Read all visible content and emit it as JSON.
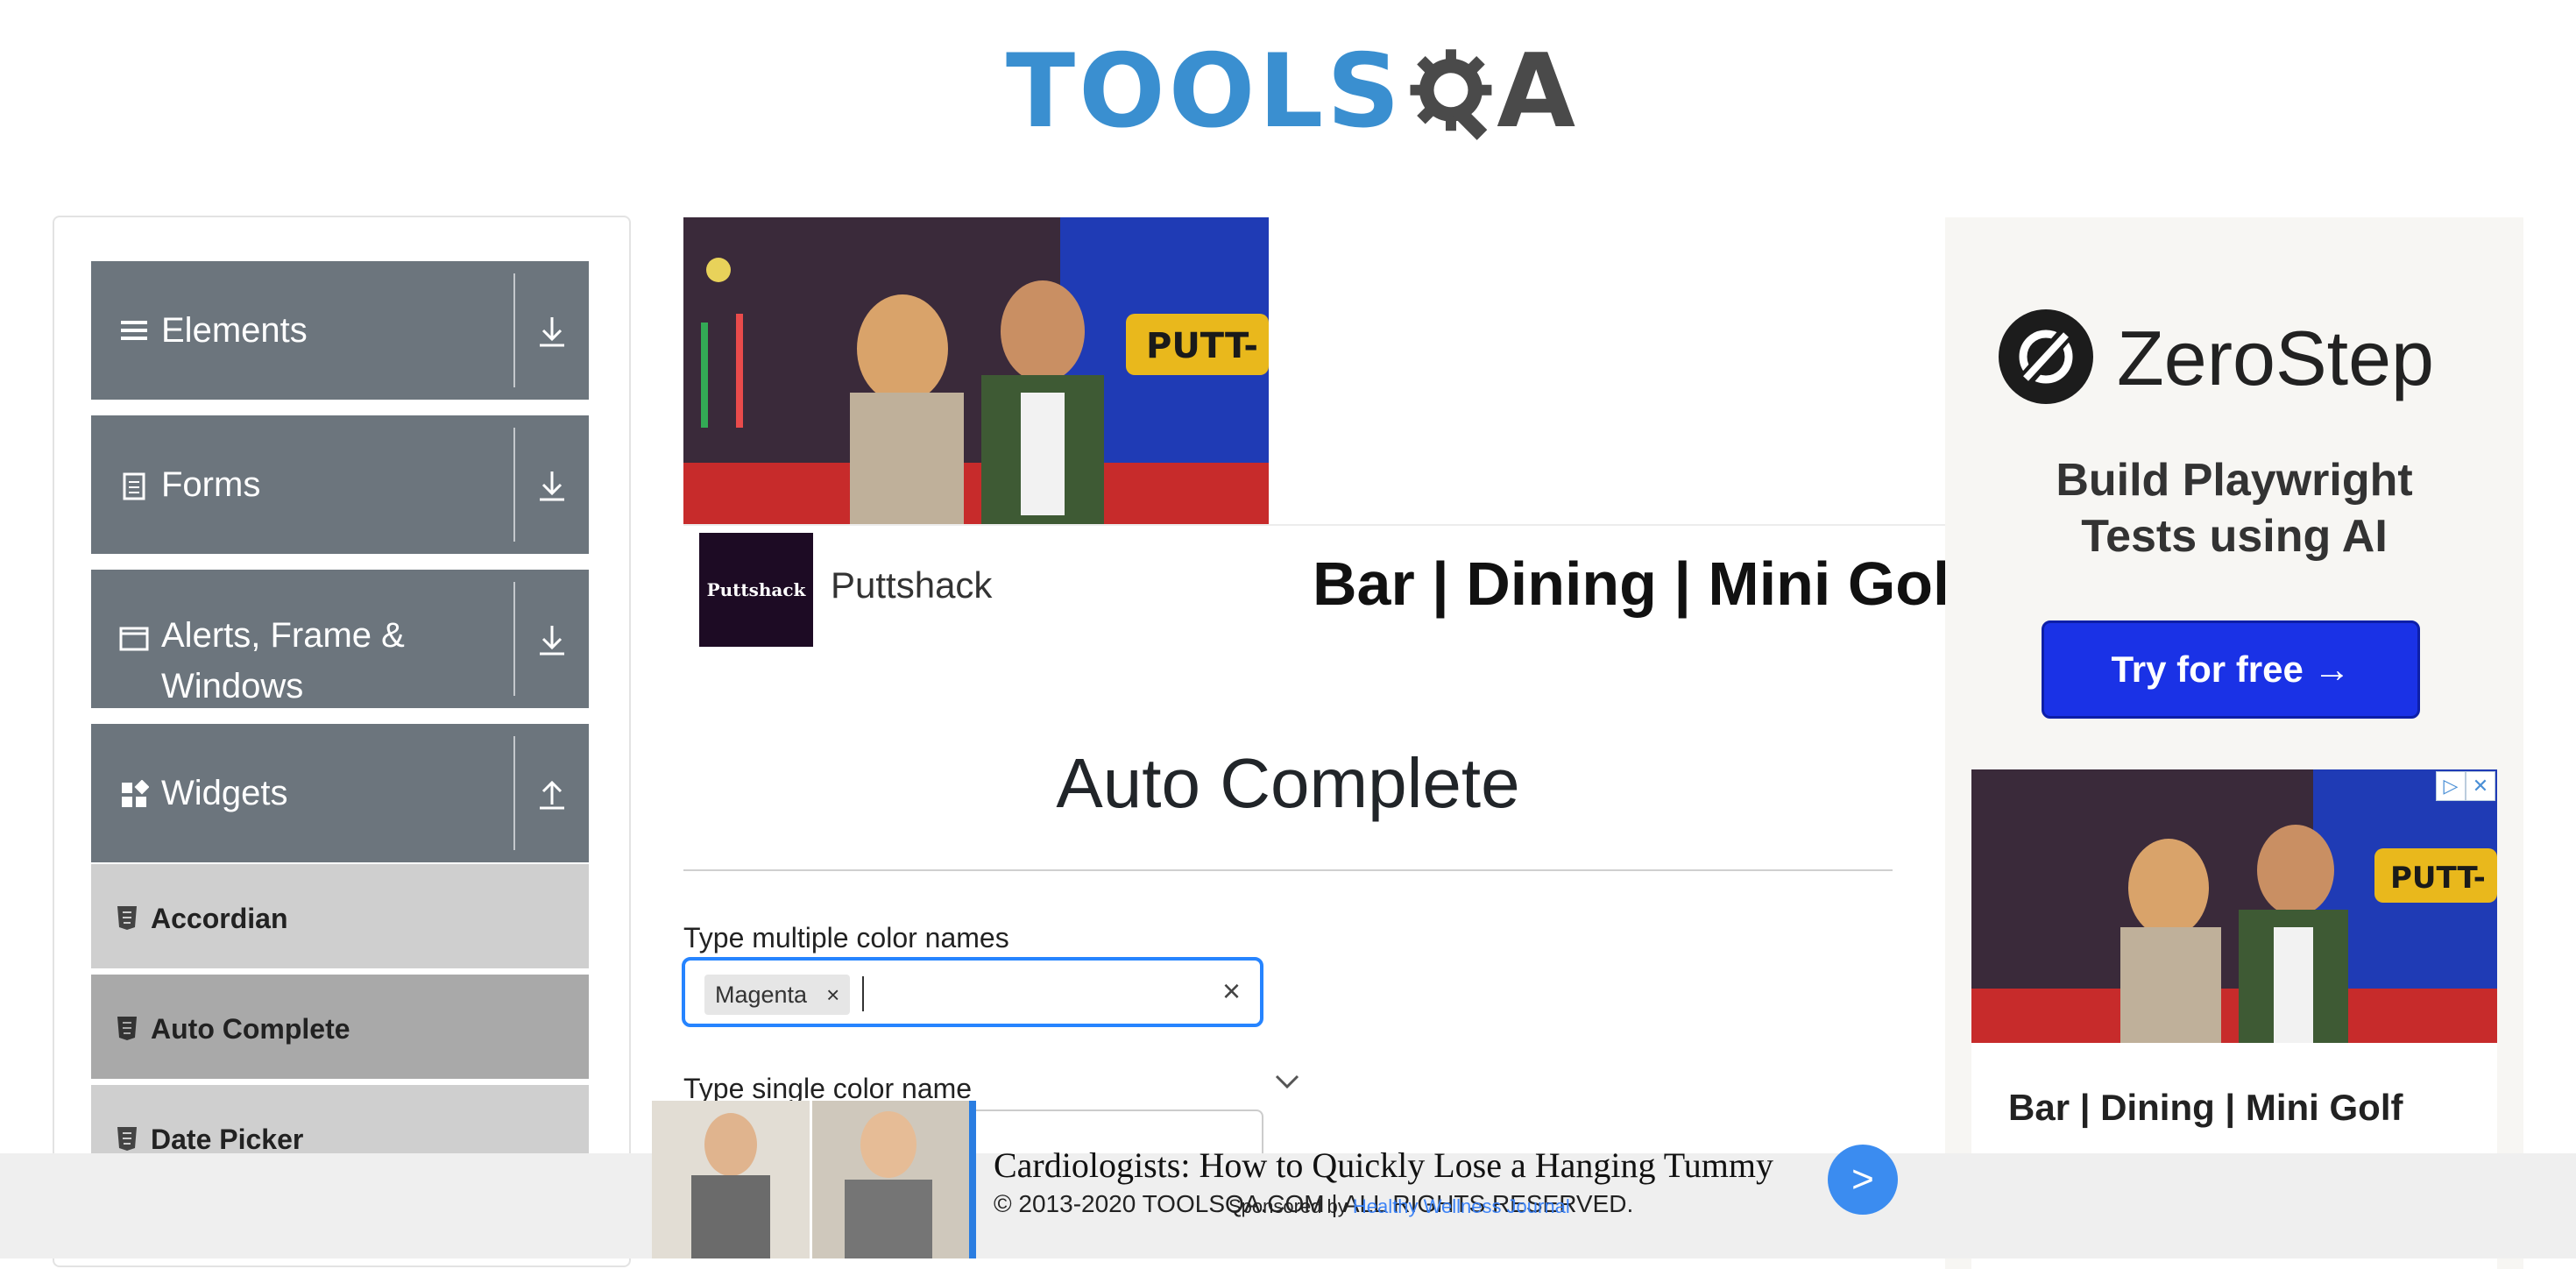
{
  "header": {
    "logo_text": "TOOLS",
    "logo_text_end": "A"
  },
  "sidebar": {
    "groups": [
      {
        "label": "Elements",
        "icon": "hamburger-icon",
        "arrow": "download-arrow-icon"
      },
      {
        "label": "Forms",
        "icon": "document-icon",
        "arrow": "download-arrow-icon"
      },
      {
        "label": "Alerts, Frame &",
        "label2": "Windows",
        "icon": "window-icon",
        "arrow": "download-arrow-icon"
      },
      {
        "label": "Widgets",
        "icon": "widgets-icon",
        "arrow": "upload-arrow-icon"
      }
    ],
    "widget_items": [
      {
        "label": "Accordian",
        "active": false
      },
      {
        "label": "Auto Complete",
        "active": true
      },
      {
        "label": "Date Picker",
        "active": false
      }
    ]
  },
  "ad_banner": {
    "headline": "Bar | Dining | Mini Golf",
    "brand_logo_text": "Puttshack",
    "brand_name": "Puttshack"
  },
  "main": {
    "title": "Auto Complete",
    "multi_label": "Type multiple color names",
    "chips": [
      "Magenta"
    ],
    "chip_remove": "×",
    "clear": "×",
    "single_label": "Type single color name"
  },
  "right_ad": {
    "brand": "ZeroStep",
    "tagline_1": "Build Playwright",
    "tagline_2": "Tests using AI",
    "cta": "Try for free →",
    "card_headline": "Bar | Dining | Mini Golf"
  },
  "footer": {
    "copyright": "© 2013-2020 TOOLSQA.COM | ALL RIGHTS RESERVED."
  },
  "sticky_ad": {
    "headline": "Cardiologists: How to Quickly Lose a Hanging Tummy",
    "sponsored_prefix": "Sponsored by",
    "sponsor": "Healthy Wellness Journal",
    "go": ">"
  },
  "colors": {
    "group_bg": "#6c757d",
    "sub_bg": "#cfcfcf",
    "sub_active_bg": "#a9a9a9",
    "focus_border": "#2684ff",
    "cta": "#1a32e6"
  }
}
